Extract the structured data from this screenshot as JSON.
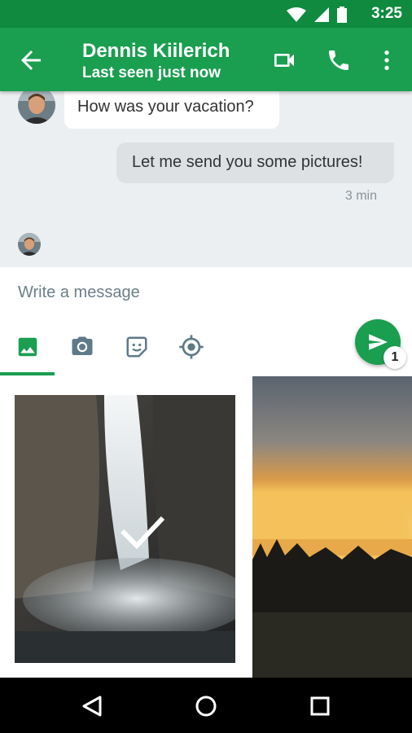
{
  "status_bar": {
    "time": "3:25",
    "icons": [
      "wifi-icon",
      "signal-icon",
      "battery-icon"
    ]
  },
  "header": {
    "contact_name": "Dennis Kiilerich",
    "status": "Last seen just now",
    "actions": [
      "video-call-icon",
      "phone-icon",
      "more-vert-icon"
    ]
  },
  "messages": [
    {
      "direction": "incoming",
      "text": "How was your vacation?"
    },
    {
      "direction": "outgoing",
      "text": "Let me send you some pictures!",
      "time": "3 min"
    }
  ],
  "compose": {
    "placeholder": "Write a message",
    "attachment_tabs": [
      "gallery-icon",
      "camera-icon",
      "sticker-icon",
      "location-icon"
    ],
    "selected_tab": "gallery-icon",
    "send_count": "1"
  },
  "gallery": {
    "photos": [
      "waterfall",
      "sunset"
    ],
    "selected": [
      "waterfall"
    ]
  },
  "nav": [
    "back-nav-icon",
    "home-nav-icon",
    "recents-nav-icon"
  ],
  "colors": {
    "primary": "#1a9e50",
    "status_bar": "#0f8a3e",
    "chat_bg": "#eceff1"
  }
}
